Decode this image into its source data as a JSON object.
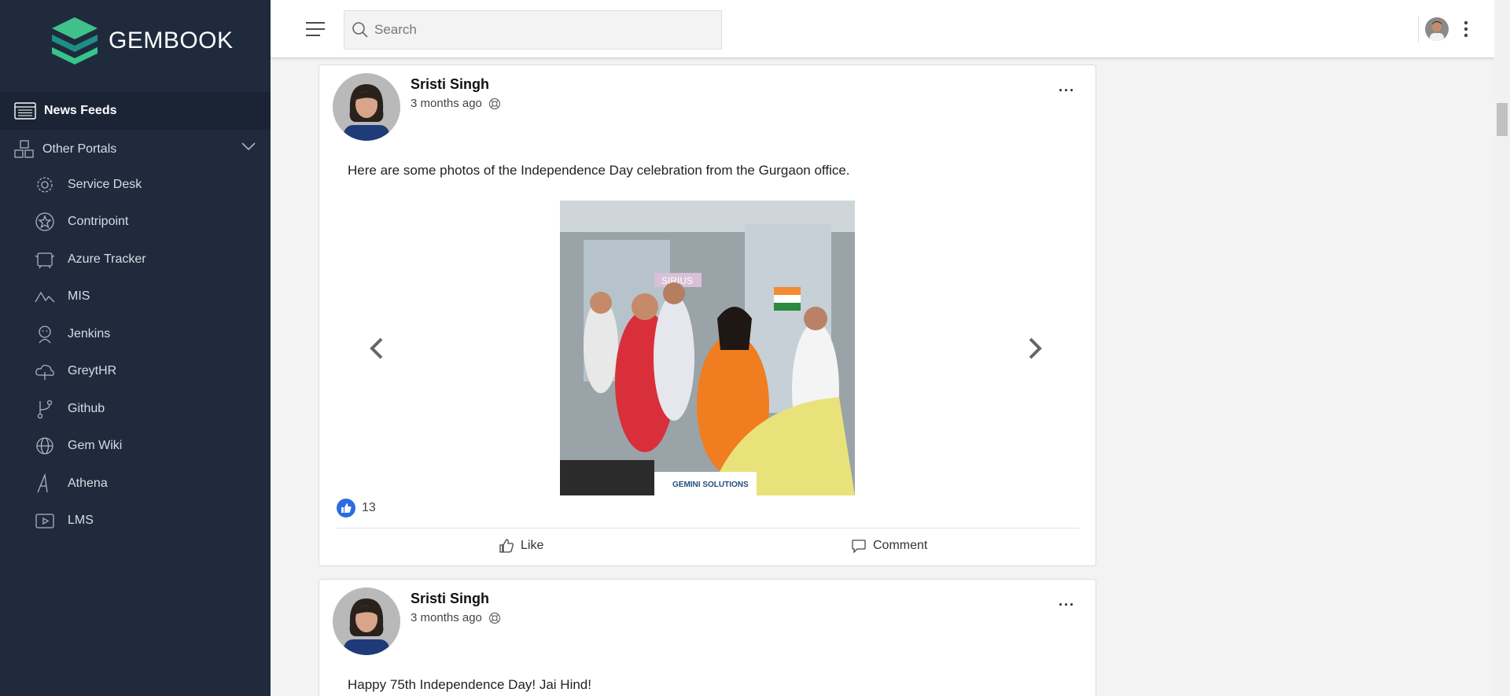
{
  "app": {
    "brand": "GEMBOOK",
    "brand_colors": [
      "#2bb673",
      "#1e8a8a",
      "#38c98a"
    ]
  },
  "sidebar": {
    "news_feeds": "News Feeds",
    "other_portals": "Other Portals",
    "portals": [
      {
        "label": "Service Desk",
        "icon": "gear-icon"
      },
      {
        "label": "Contripoint",
        "icon": "star-icon"
      },
      {
        "label": "Azure Tracker",
        "icon": "tracker-icon"
      },
      {
        "label": "MIS",
        "icon": "chart-icon"
      },
      {
        "label": "Jenkins",
        "icon": "jenkins-icon"
      },
      {
        "label": "GreytHR",
        "icon": "cloud-icon"
      },
      {
        "label": "Github",
        "icon": "branch-icon"
      },
      {
        "label": "Gem Wiki",
        "icon": "globe-icon"
      },
      {
        "label": "Athena",
        "icon": "athena-icon"
      },
      {
        "label": "LMS",
        "icon": "video-icon"
      }
    ]
  },
  "header": {
    "search_placeholder": "Search"
  },
  "posts": [
    {
      "author": "Sristi Singh",
      "time": "3 months ago",
      "text": "Here are some photos of the Independence Day celebration from the Gurgaon office.",
      "photo_caption": "SIRIUS",
      "photo_watermark": "GEMINI SOLUTIONS",
      "likes": "13",
      "like_label": "Like",
      "comment_label": "Comment"
    },
    {
      "author": "Sristi Singh",
      "time": "3 months ago",
      "text": "Happy 75th Independence Day! Jai Hind!"
    }
  ]
}
